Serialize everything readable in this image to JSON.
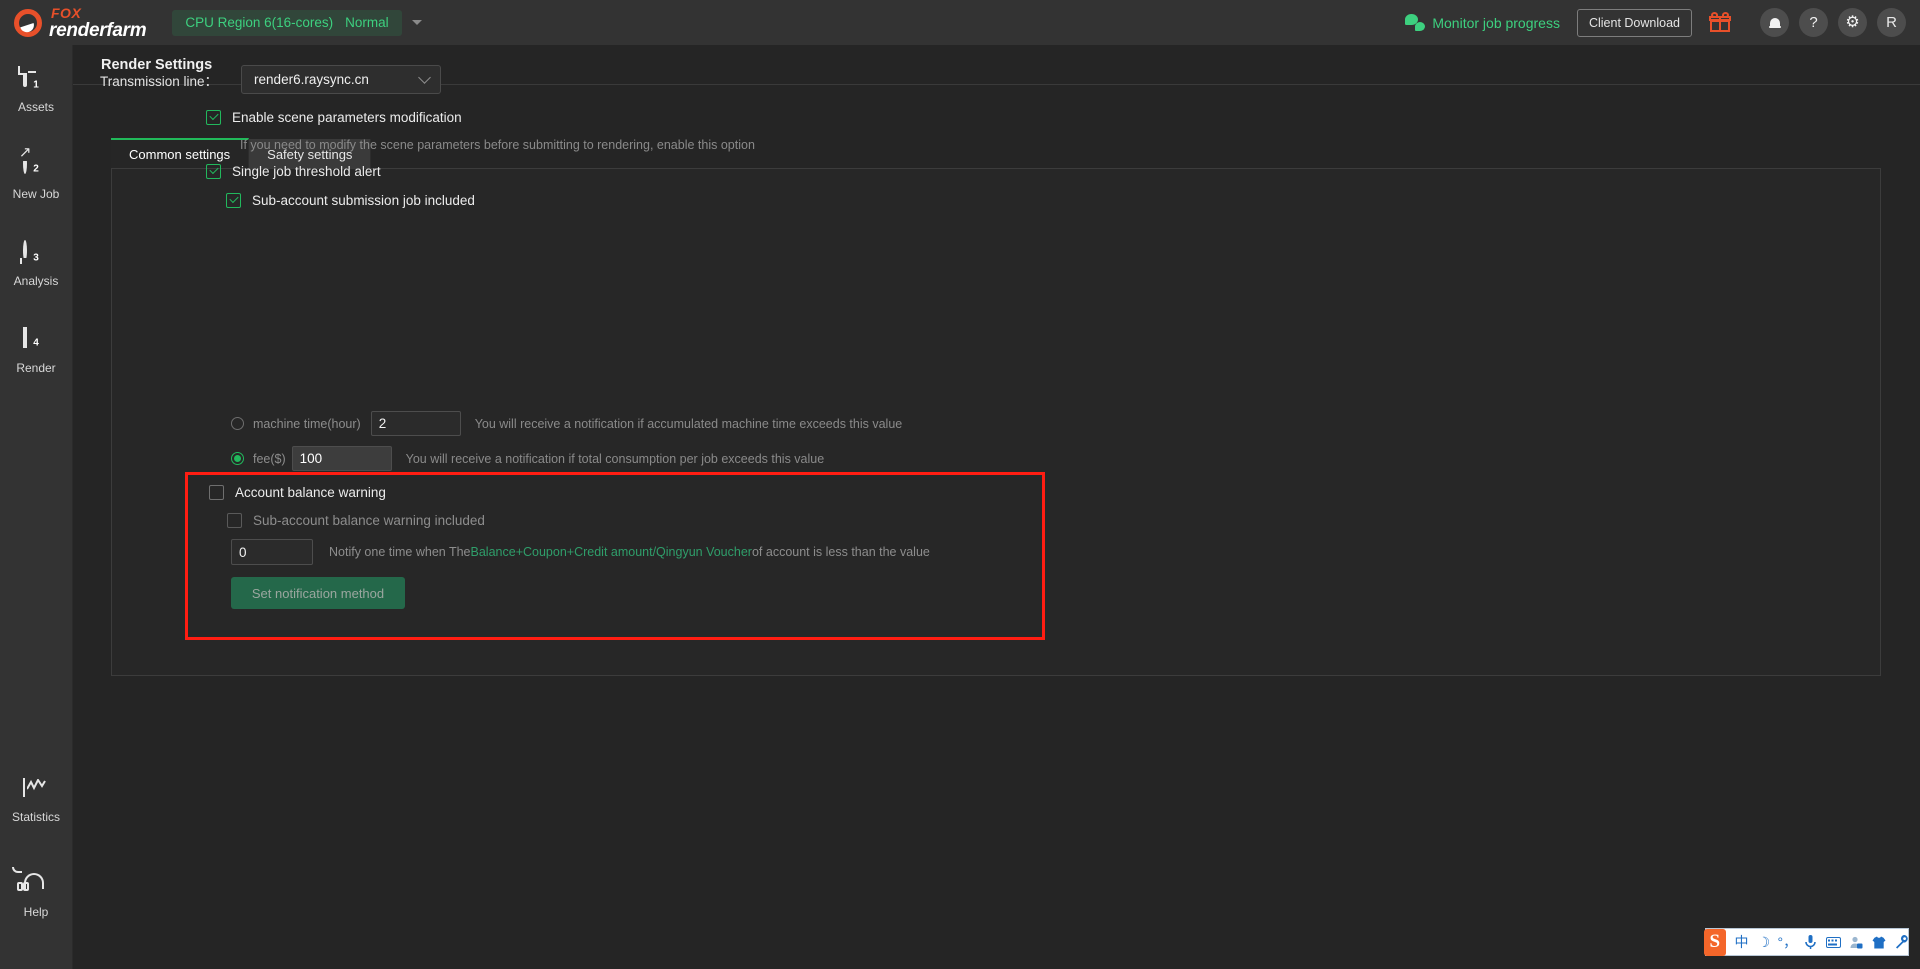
{
  "header": {
    "logo": {
      "top": "FOX",
      "bottom": "renderfarm",
      "icon": "fox-logo-icon",
      "color": "#e8502a"
    },
    "region_badge": {
      "text": "CPU Region 6(16-cores)",
      "status": "Normal",
      "color": "#3dd07f",
      "bg": "#31463a"
    },
    "wechat_link": "Monitor job progress",
    "client_download": "Client Download",
    "icons": [
      "gift-icon",
      "bell-icon",
      "help-icon",
      "gear-icon"
    ],
    "help_glyph": "?",
    "gear_glyph": "⚙",
    "avatar": "R"
  },
  "sidebar": {
    "items": [
      {
        "label": "Assets",
        "icon": "assets-doc-icon",
        "badge": "1"
      },
      {
        "label": "New Job",
        "icon": "new-job-circle-arrow-icon",
        "badge": "2"
      },
      {
        "label": "Analysis",
        "icon": "analysis-target-icon",
        "badge": "3"
      },
      {
        "label": "Render",
        "icon": "render-diamond-icon",
        "badge": "4"
      }
    ],
    "bottom_items": [
      {
        "label": "Statistics",
        "icon": "statistics-chart-icon"
      },
      {
        "label": "Help",
        "icon": "help-headset-icon"
      }
    ]
  },
  "page": {
    "title": "Render Settings"
  },
  "tabs": [
    {
      "label": "Common settings",
      "active": true
    },
    {
      "label": "Safety settings",
      "active": false
    }
  ],
  "form": {
    "transmission_line": {
      "label": "Transmission line：",
      "value": "render6.raysync.cn",
      "options": [
        "render6.raysync.cn"
      ]
    },
    "scene_params": {
      "label": "Enable scene parameters modification",
      "checked": true,
      "helper": "If you need to modify the scene parameters before submitting to rendering, enable this option"
    },
    "threshold_alert": {
      "label": "Single job threshold alert",
      "checked": true
    },
    "sub_account_submission": {
      "label": "Sub-account submission job included",
      "checked": true
    },
    "machine_time": {
      "radio_label": "machine time(hour)",
      "selected": false,
      "value": "2",
      "helper": "You will receive a notification if accumulated machine time exceeds this value"
    },
    "fee": {
      "radio_label": "fee($)",
      "selected": true,
      "value": "100",
      "helper": "You will receive a notification if total consumption per job exceeds this value"
    },
    "balance_warning": {
      "label": "Account balance warning",
      "checked": false,
      "highlight_color": "#ff1d12"
    },
    "sub_balance_warning": {
      "label": "Sub-account balance warning included",
      "checked": false
    },
    "notify_threshold": {
      "value": "0",
      "text_before": "Notify one time when The",
      "text_link": "Balance+Coupon+Credit amount/Qingyun Voucher",
      "text_after": "of account is less than the value",
      "link_color": "#2f9e6a"
    },
    "notification_button": {
      "label": "Set notification method",
      "disabled": true,
      "bg": "#24684a"
    }
  },
  "ime": {
    "logo": "S",
    "items": [
      "中",
      "☽",
      "°，",
      "mic-icon",
      "keyboard-icon",
      "user-lock-icon",
      "skin-icon",
      "wrench-icon"
    ],
    "glyphs": {
      "lang": "中",
      "moon": "☽",
      "punct": "°，",
      "mic": "🎙",
      "keyboard": "⌨",
      "user": "♟",
      "skin": "♣",
      "wrench": "⚒"
    }
  }
}
